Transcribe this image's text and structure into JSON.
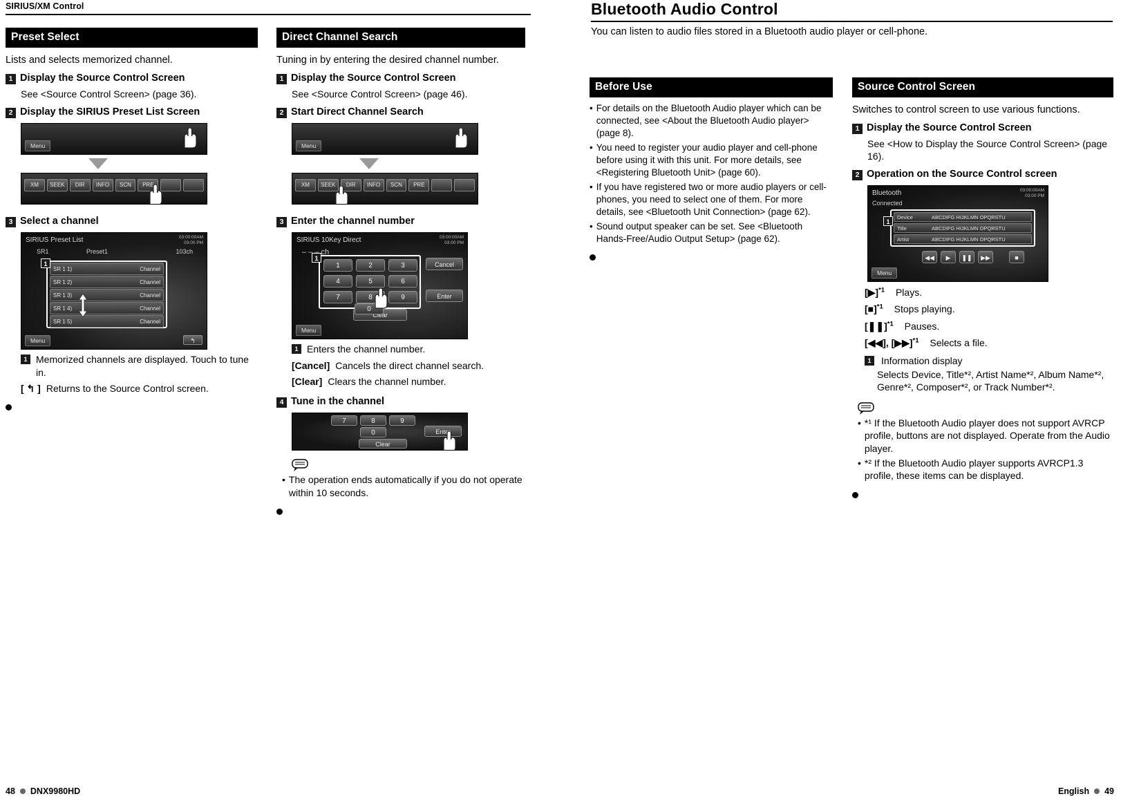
{
  "left_page": {
    "running_head": "SIRIUS/XM Control",
    "column_a": {
      "section_title": "Preset Select",
      "intro": "Lists and selects memorized channel.",
      "steps": [
        {
          "num": "1",
          "title": "Display the Source Control Screen",
          "sub": "See <Source Control Screen> (page 36)."
        },
        {
          "num": "2",
          "title": "Display the SIRIUS Preset List Screen"
        },
        {
          "num": "3",
          "title": "Select a channel"
        }
      ],
      "screen1": {
        "menu_label": "Menu",
        "buttons": [
          "XM",
          "SEEK",
          "DIR",
          "INFO",
          "SCN",
          "PRE",
          "",
          ""
        ]
      },
      "screen2": {
        "title": "SIRIUS Preset List",
        "clock": "03:00:00AM\n03:00 PM",
        "line_left": "SR1",
        "line_mid": "Preset1",
        "line_right": "103ch",
        "menu_label": "Menu",
        "rows": [
          {
            "left": "SR 1   1)",
            "right": "Channel"
          },
          {
            "left": "SR 1   2)",
            "right": "Channel"
          },
          {
            "left": "SR 1   3)",
            "right": "Channel"
          },
          {
            "left": "SR 1   4)",
            "right": "Channel"
          },
          {
            "left": "SR 1   5)",
            "right": "Channel"
          }
        ],
        "callout": "1"
      },
      "notes": [
        {
          "mark": "1",
          "text": "Memorized channels are displayed. Touch to tune in."
        },
        {
          "mark": "[ ↰ ]",
          "text": "Returns to the Source Control screen."
        }
      ]
    },
    "column_b": {
      "section_title": "Direct Channel Search",
      "intro": "Tuning in by entering the desired channel number.",
      "steps": [
        {
          "num": "1",
          "title": "Display the Source Control Screen",
          "sub": "See <Source Control Screen> (page 46)."
        },
        {
          "num": "2",
          "title": "Start Direct Channel Search"
        },
        {
          "num": "3",
          "title": "Enter the channel number"
        },
        {
          "num": "4",
          "title": "Tune in the channel"
        }
      ],
      "screen1": {
        "menu_label": "Menu",
        "buttons": [
          "XM",
          "SEEK",
          "DIR",
          "INFO",
          "SCN",
          "PRE",
          "",
          ""
        ]
      },
      "screen_keypad": {
        "title": "SIRIUS 10Key Direct",
        "clock": "03:00:00AM\n03:00 PM",
        "display": "– – – ch",
        "menu_label": "Menu",
        "keys": [
          "1",
          "2",
          "3",
          "4",
          "5",
          "6",
          "7",
          "8",
          "9",
          "0"
        ],
        "cancel": "Cancel",
        "enter": "Enter",
        "clear": "Clear",
        "callout": "1"
      },
      "screen_small": {
        "keys": [
          "7",
          "8",
          "9",
          "0"
        ],
        "clear": "Clear",
        "enter": "Enter"
      },
      "definitions": [
        {
          "term": "1",
          "text": "Enters the channel number."
        },
        {
          "term": "[Cancel]",
          "text": "Cancels the direct channel search."
        },
        {
          "term": "[Clear]",
          "text": "Clears the channel number."
        }
      ],
      "note": "The operation ends automatically if you do not operate within 10 seconds."
    },
    "footer": {
      "page": "48",
      "model": "DNX9980HD"
    }
  },
  "right_page": {
    "title": "Bluetooth Audio Control",
    "subtitle": "You can listen to audio files stored in a Bluetooth audio player or cell-phone.",
    "before_use": {
      "section_title": "Before Use",
      "bullets": [
        "For details on the Bluetooth Audio player which can be connected, see <About the Bluetooth Audio player> (page 8).",
        "You need to register your audio player and cell-phone before using it with this unit. For more details, see <Registering Bluetooth Unit> (page 60).",
        "If you have registered two or more audio players or cell-phones, you need to select one of them. For more details, see <Bluetooth Unit Connection> (page 62).",
        "Sound output speaker can be set. See <Bluetooth Hands-Free/Audio Output Setup> (page 62)."
      ]
    },
    "source_control": {
      "section_title": "Source Control Screen",
      "intro": "Switches  to control screen to use various functions.",
      "steps": [
        {
          "num": "1",
          "title": "Display the Source Control Screen",
          "sub": "See <How to Display the Source Control Screen> (page 16)."
        },
        {
          "num": "2",
          "title": "Operation on the Source Control screen"
        }
      ],
      "screen": {
        "title": "Bluetooth",
        "status": "Connected",
        "clock": "03:00:00AM\n03:00 PM",
        "menu_label": "Menu",
        "rows": [
          {
            "label": "Device",
            "value": "ABCDIFG HIJKLMN OPQRSTU"
          },
          {
            "label": "Title",
            "value": "ABCDIFG HIJKLMN OPQRSTU"
          },
          {
            "label": "Artist",
            "value": "ABCDIFG HIJKLMN OPQRSTU"
          }
        ],
        "callout": "1"
      },
      "keys": [
        {
          "key": "[▶]",
          "sup": "*1",
          "desc": "Plays."
        },
        {
          "key": "[■]",
          "sup": "*1",
          "desc": "Stops playing."
        },
        {
          "key": "[❚❚]",
          "sup": "*1",
          "desc": "Pauses."
        },
        {
          "key": "[◀◀], [▶▶]",
          "sup": "*1",
          "desc": "Selects a file."
        }
      ],
      "info_display": {
        "mark": "1",
        "label": "Information display",
        "text": "Selects Device, Title*², Artist Name*², Album Name*², Genre*², Composer*², or Track Number*²."
      },
      "notes": [
        "*¹ If the Bluetooth Audio player does not support AVRCP profile, buttons are not displayed. Operate from the Audio player.",
        "*² If the Bluetooth Audio player supports AVRCP1.3 profile, these items can be displayed."
      ]
    },
    "footer": {
      "language": "English",
      "page": "49"
    }
  }
}
